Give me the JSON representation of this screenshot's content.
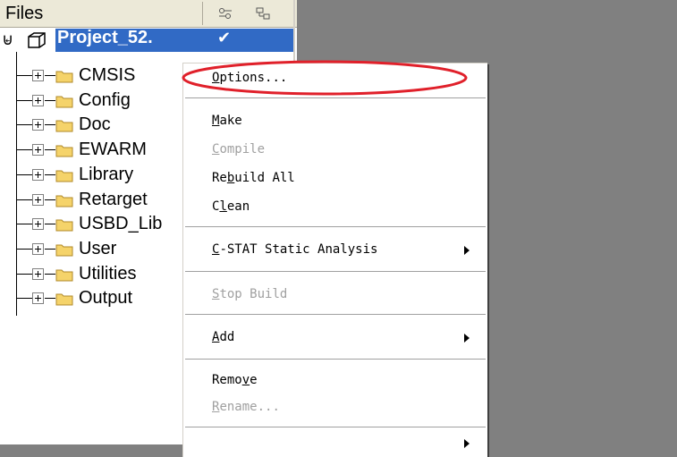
{
  "panel": {
    "header_title": "Files",
    "header_icons": [
      "options-settings-icon",
      "tree-layout-icon"
    ]
  },
  "tree": {
    "root": {
      "label": "Project_52.",
      "check": "✔",
      "expander": "⊌"
    },
    "folders": [
      {
        "label": "CMSIS"
      },
      {
        "label": "Config"
      },
      {
        "label": "Doc"
      },
      {
        "label": "EWARM"
      },
      {
        "label": "Library"
      },
      {
        "label": "Retarget"
      },
      {
        "label": "USBD_Lib"
      },
      {
        "label": "User"
      },
      {
        "label": "Utilities"
      },
      {
        "label": "Output"
      }
    ]
  },
  "context_menu": {
    "options": {
      "mnemonic": "O",
      "rest": "ptions..."
    },
    "make": {
      "mnemonic": "M",
      "rest": "ake"
    },
    "compile": {
      "mnemonic": "C",
      "rest": "ompile"
    },
    "rebuild_all": {
      "pre": "Re",
      "mnemonic": "b",
      "rest": "uild All"
    },
    "clean": {
      "pre": "C",
      "mnemonic": "l",
      "rest": "ean"
    },
    "cstat": {
      "mnemonic": "C",
      "rest": "-STAT Static Analysis"
    },
    "stop_build": {
      "mnemonic": "S",
      "rest": "top Build"
    },
    "add": {
      "mnemonic": "A",
      "rest": "dd"
    },
    "remove": {
      "pre": "Remo",
      "mnemonic": "v",
      "rest": "e"
    },
    "rename": {
      "mnemonic": "R",
      "rest": "ename..."
    }
  },
  "colors": {
    "selection": "#316ac5",
    "highlight_ring": "#e0202a",
    "folder": "#f5d36a"
  }
}
